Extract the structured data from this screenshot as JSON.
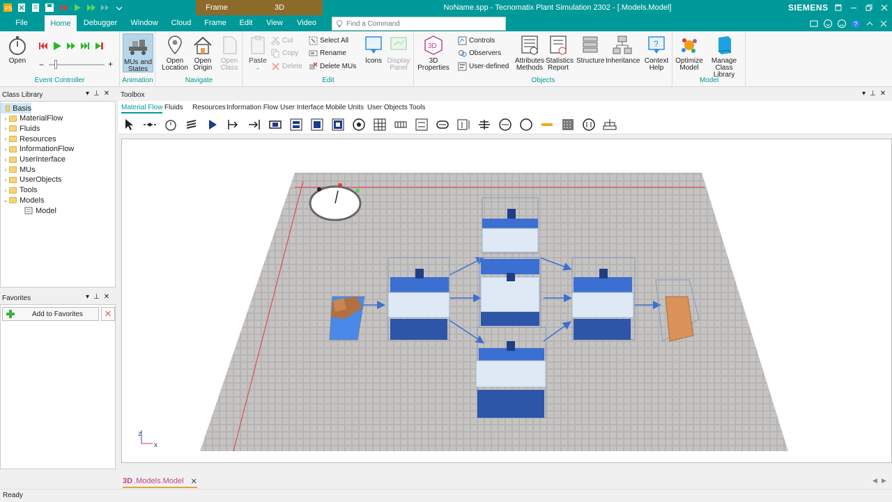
{
  "titlebar": {
    "title": "NoName.spp - Tecnomatix Plant Simulation 2302 - [.Models.Model]",
    "brand": "SIEMENS",
    "context_tabs": {
      "frame": "Frame",
      "threed": "3D"
    }
  },
  "tabs": {
    "file": "File",
    "home": "Home",
    "debugger": "Debugger",
    "window": "Window",
    "cloud": "Cloud",
    "frame": "Frame",
    "edit": "Edit",
    "view": "View",
    "video": "Video"
  },
  "search": {
    "placeholder": "Find a Command"
  },
  "ribbon": {
    "event_controller": {
      "open": "Open",
      "label": "Event Controller"
    },
    "animation": {
      "mus_and_states_line1": "MUs and",
      "mus_and_states_line2": "States",
      "label": "Animation"
    },
    "navigate": {
      "open_location_line1": "Open",
      "open_location_line2": "Location",
      "open_origin_line1": "Open",
      "open_origin_line2": "Origin",
      "open_class_line1": "Open",
      "open_class_line2": "Class",
      "label": "Navigate"
    },
    "edit": {
      "paste": "Paste",
      "cut": "Cut",
      "copy": "Copy",
      "delete": "Delete",
      "select_all": "Select All",
      "rename": "Rename",
      "delete_mus": "Delete MUs",
      "label": "Edit"
    },
    "objects": {
      "icons": "Icons",
      "display_panel_line1": "Display",
      "display_panel_line2": "Panel",
      "threed_properties_line1": "3D",
      "threed_properties_line2": "Properties",
      "controls": "Controls",
      "observers": "Observers",
      "user_defined": "User-defined",
      "attributes_methods_line1": "Attributes",
      "attributes_methods_line2": "Methods",
      "statistics_report_line1": "Statistics",
      "statistics_report_line2": "Report",
      "structure": "Structure",
      "inheritance": "Inheritance",
      "context_help_line1": "Context",
      "context_help_line2": "Help",
      "label": "Objects"
    },
    "model": {
      "optimize_line1": "Optimize",
      "optimize_line2": "Model",
      "manage_line1": "Manage",
      "manage_line2": "Class Library",
      "label": "Model"
    }
  },
  "class_library": {
    "title": "Class Library",
    "items": [
      {
        "label": "Basis",
        "level": 0,
        "kind": "root",
        "expander": ""
      },
      {
        "label": "MaterialFlow",
        "level": 1,
        "kind": "folder",
        "expander": "›"
      },
      {
        "label": "Fluids",
        "level": 1,
        "kind": "folder",
        "expander": "›"
      },
      {
        "label": "Resources",
        "level": 1,
        "kind": "folder",
        "expander": "›"
      },
      {
        "label": "InformationFlow",
        "level": 1,
        "kind": "folder",
        "expander": "›"
      },
      {
        "label": "UserInterface",
        "level": 1,
        "kind": "folder",
        "expander": "›"
      },
      {
        "label": "MUs",
        "level": 1,
        "kind": "folder",
        "expander": "›"
      },
      {
        "label": "UserObjects",
        "level": 1,
        "kind": "folder",
        "expander": "›"
      },
      {
        "label": "Tools",
        "level": 1,
        "kind": "folder",
        "expander": "›"
      },
      {
        "label": "Models",
        "level": 1,
        "kind": "folder",
        "expander": "⌄"
      },
      {
        "label": "Model",
        "level": 2,
        "kind": "frame",
        "expander": ""
      }
    ]
  },
  "favorites": {
    "title": "Favorites",
    "add_label": "Add to Favorites"
  },
  "toolbox": {
    "title": "Toolbox",
    "tabs": [
      "Material Flow",
      "Fluids",
      "Resources",
      "Information Flow",
      "User Interface",
      "Mobile Units",
      "User Objects",
      "Tools"
    ]
  },
  "viewport": {
    "axis_z": "z",
    "axis_x": "x"
  },
  "doc_tab": {
    "prefix": "3D",
    "label": ".Models.Model"
  },
  "status": {
    "text": "Ready"
  },
  "colors": {
    "accent": "#009999",
    "context_tab": "#8c6b2a",
    "station_blue": "#3b6fd1",
    "floor": "#b8b5b5"
  }
}
